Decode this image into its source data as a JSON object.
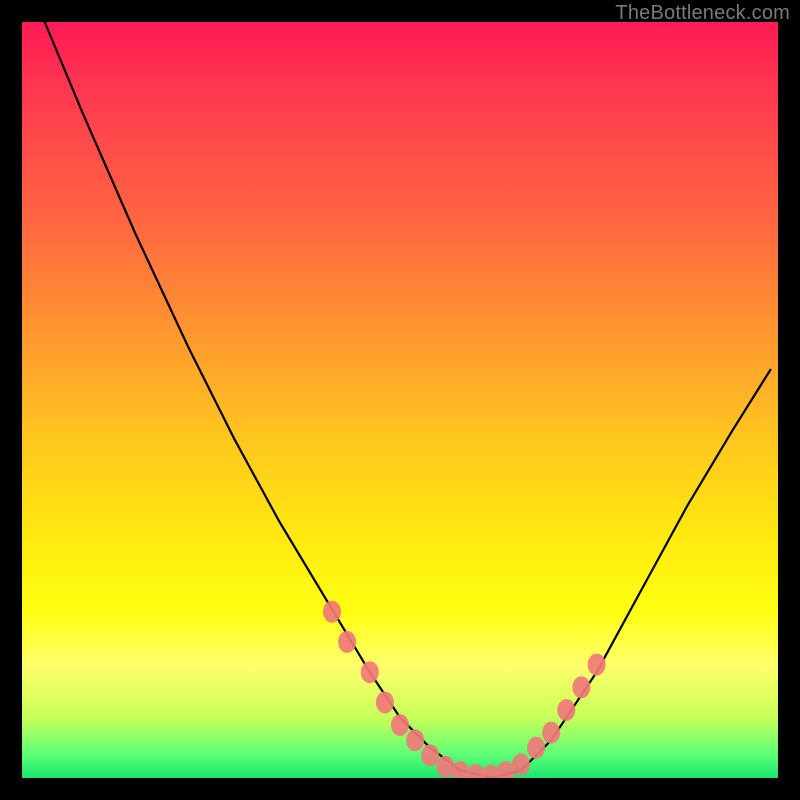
{
  "watermark": "TheBottleneck.com",
  "colors": {
    "background": "#000000",
    "gradient_top": "#ff1a55",
    "gradient_mid1": "#ff9a2e",
    "gradient_mid2": "#ffe90f",
    "gradient_bottom": "#19e56b",
    "curve": "#000000",
    "dots": "#f07878",
    "watermark": "#7a7a7a"
  },
  "chart_data": {
    "type": "line",
    "title": "",
    "xlabel": "",
    "ylabel": "",
    "xlim": [
      0,
      100
    ],
    "ylim": [
      0,
      100
    ],
    "grid": false,
    "legend": false,
    "series": [
      {
        "name": "curve",
        "x": [
          3,
          8,
          15,
          22,
          28,
          34,
          40,
          46,
          50,
          54,
          58,
          62,
          66,
          70,
          76,
          82,
          88,
          94,
          99
        ],
        "y": [
          100,
          88,
          72,
          57,
          45,
          34,
          24,
          14,
          8,
          4,
          1,
          0,
          1,
          5,
          14,
          25,
          36,
          46,
          54
        ]
      }
    ],
    "annotations": {
      "dots": [
        {
          "x": 41,
          "y": 22
        },
        {
          "x": 43,
          "y": 18
        },
        {
          "x": 46,
          "y": 14
        },
        {
          "x": 48,
          "y": 10
        },
        {
          "x": 50,
          "y": 7
        },
        {
          "x": 52,
          "y": 5
        },
        {
          "x": 54,
          "y": 3
        },
        {
          "x": 56,
          "y": 1.5
        },
        {
          "x": 58,
          "y": 0.8
        },
        {
          "x": 60,
          "y": 0.4
        },
        {
          "x": 62,
          "y": 0.3
        },
        {
          "x": 64,
          "y": 0.8
        },
        {
          "x": 66,
          "y": 1.8
        },
        {
          "x": 68,
          "y": 4
        },
        {
          "x": 70,
          "y": 6
        },
        {
          "x": 72,
          "y": 9
        },
        {
          "x": 74,
          "y": 12
        },
        {
          "x": 76,
          "y": 15
        }
      ]
    }
  }
}
